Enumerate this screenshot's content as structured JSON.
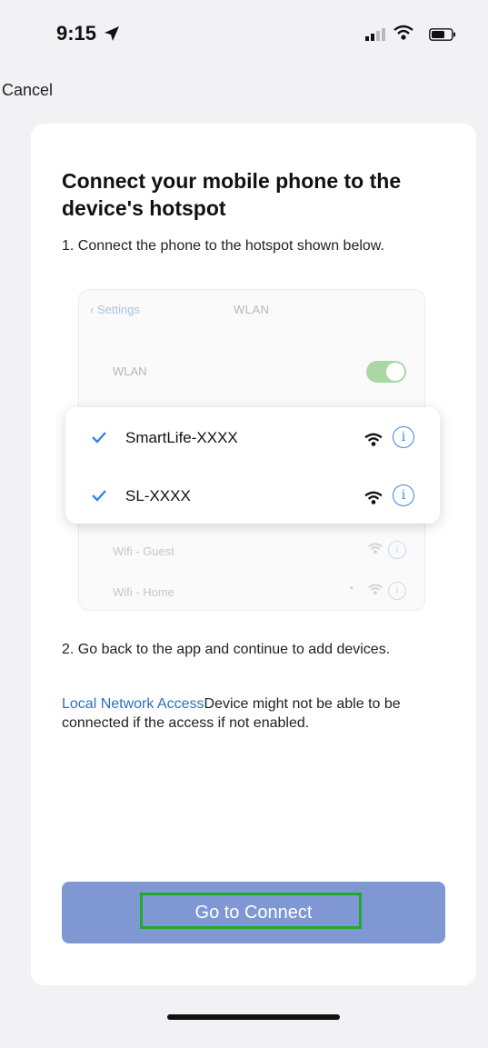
{
  "status_bar": {
    "time": "9:15"
  },
  "nav": {
    "cancel_label": "Cancel"
  },
  "card": {
    "title": "Connect your mobile phone to the device's hotspot",
    "step1": "1. Connect the phone to the hotspot shown below.",
    "illustration": {
      "back_label": "Settings",
      "nav_title": "WLAN",
      "wlan_label": "WLAN",
      "selected_networks": [
        "SmartLife-XXXX",
        "SL-XXXX"
      ],
      "other_networks": [
        "Wifi - Guest",
        "Wifi - Home"
      ]
    },
    "step2": "2. Go back to the app and continue to add devices.",
    "note_link": "Local Network Access",
    "note_text": "Device might not be able to be connected if the access if not enabled.",
    "connect_button": "Go to Connect"
  },
  "colors": {
    "button_bg": "#7f98d4",
    "highlight_border": "#1eaa2a",
    "link": "#2d6fbf",
    "check": "#3c82e8"
  }
}
